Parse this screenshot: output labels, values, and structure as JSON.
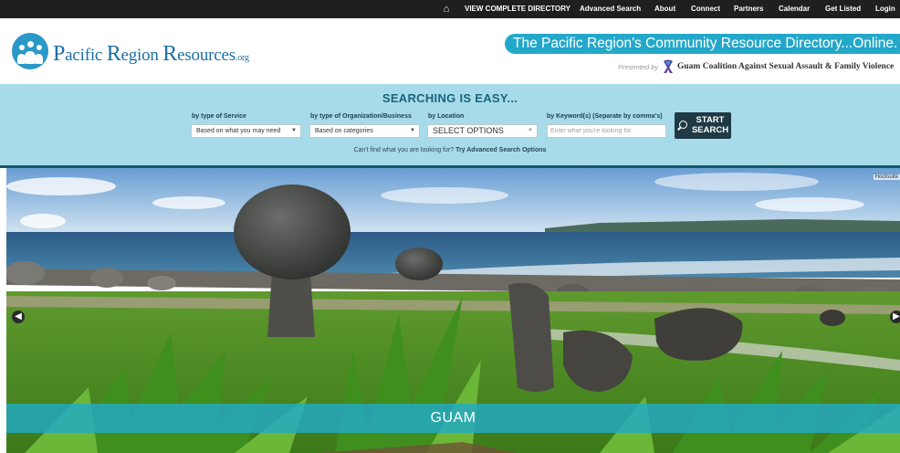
{
  "nav": {
    "items": [
      "VIEW COMPLETE DIRECTORY",
      "Advanced Search",
      "About",
      "Connect",
      "Partners",
      "Calendar",
      "Get Listed",
      "Login"
    ]
  },
  "header": {
    "logo": {
      "part1": "P",
      "part2": "acific ",
      "part3": "R",
      "part4": "egion ",
      "part5": "R",
      "part6": "esources",
      "part7": ".org"
    },
    "tagline": "The Pacific Region's Community Resource Directory...Online.",
    "presented_by": "Presented by",
    "partner": "Guam Coalition Against Sexual Assault & Family Violence"
  },
  "search": {
    "title": "SEARCHING IS EASY...",
    "service_label": "by type of Service",
    "service_value": "Based on what you may need",
    "org_label": "by type of Organization/Business",
    "org_value": "Based on categories",
    "location_label": "by Location",
    "location_value": "SELECT OPTIONS",
    "keyword_label": "by Keyword(s) (Separate by comma's)",
    "keyword_placeholder": "Enter what you're looking for",
    "button_line1": "START",
    "button_line2": "SEARCH",
    "cant_find": "Can't find what you are looking for?",
    "advanced_link": "Try Advanced Search Options"
  },
  "hero": {
    "badge": "Hootsuite",
    "caption": "GUAM"
  },
  "colors": {
    "nav_bg": "#1f1f1f",
    "brand_blue": "#1c6fa3",
    "tagline_bg": "#24a8c9",
    "search_bg": "#a8dbe9",
    "button_bg": "#1f3a45",
    "caption_bg": "#22aac6"
  }
}
